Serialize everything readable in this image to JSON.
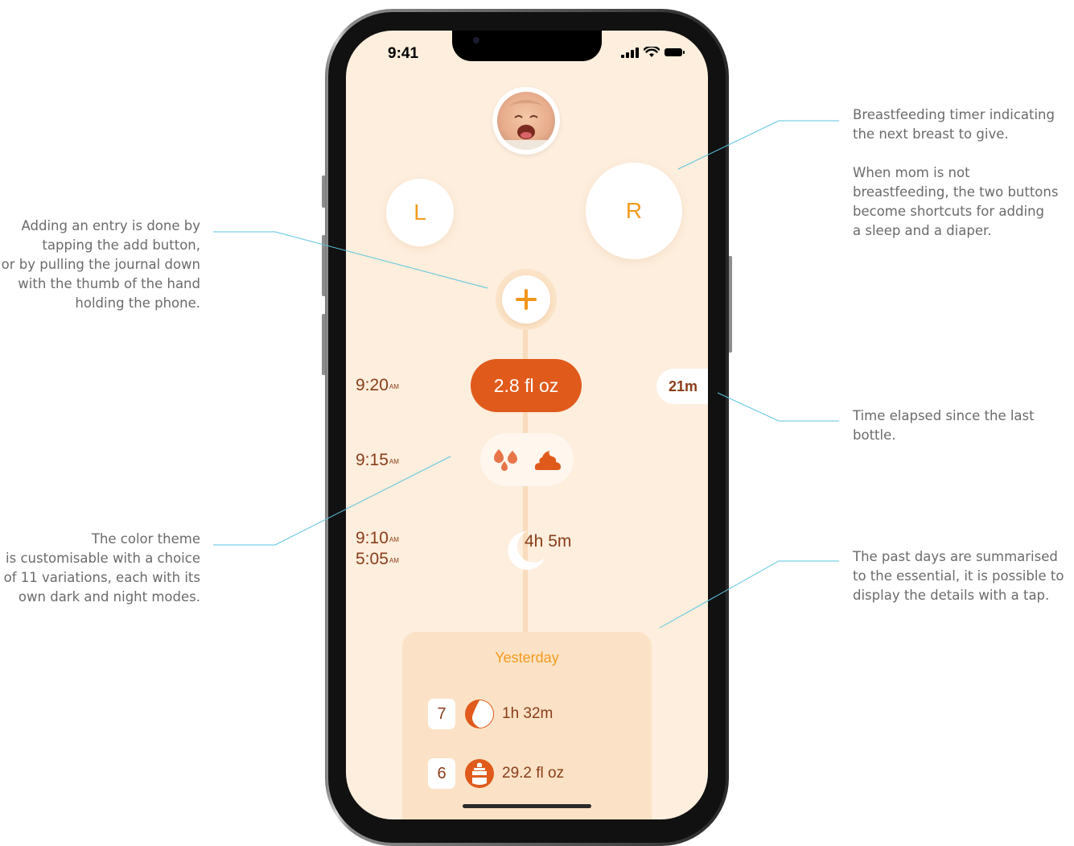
{
  "annotations": {
    "breastfeeding": [
      "Breastfeeding timer indicating",
      "the next breast to give."
    ],
    "mom_not_feeding": [
      "When mom is not",
      "breastfeeding, the two buttons",
      "become shortcuts for adding",
      "a sleep and a diaper."
    ],
    "adding_entry": [
      "Adding an entry is done by",
      "tapping the add button,",
      "or by pulling the journal down",
      "with the thumb of the hand",
      "holding the phone."
    ],
    "elapsed": [
      "Time elapsed since the last",
      "bottle."
    ],
    "color_theme": [
      "The color theme",
      "is customisable with a choice",
      "of 11 variations, each with its",
      "own dark and night modes."
    ],
    "past_days": [
      "The past days are summarised",
      "to the essential, it is possible to",
      "display the details with a tap."
    ]
  },
  "status_bar": {
    "time": "9:41"
  },
  "breast_buttons": {
    "left": "L",
    "right": "R"
  },
  "add_button": {
    "label": "+"
  },
  "timeline": {
    "bottle": {
      "time": "9:20",
      "ampm": "AM",
      "amount": "2.8 fl oz",
      "elapsed": "21m"
    },
    "diaper": {
      "time": "9:15",
      "ampm": "AM"
    },
    "sleep": {
      "end_time": "9:10",
      "end_ampm": "AM",
      "start_time": "5:05",
      "start_ampm": "AM",
      "duration": "4h 5m"
    }
  },
  "yesterday": {
    "title": "Yesterday",
    "rows": [
      {
        "count": "7",
        "icon": "breastfeeding-icon",
        "value": "1h 32m"
      },
      {
        "count": "6",
        "icon": "bottle-icon",
        "value": "29.2 fl oz"
      }
    ]
  },
  "colors": {
    "accent": "#f29b1f",
    "bottle": "#e05a1c",
    "text": "#8a3d1a",
    "background": "#fdeedd",
    "line": "#5bc4e0"
  }
}
